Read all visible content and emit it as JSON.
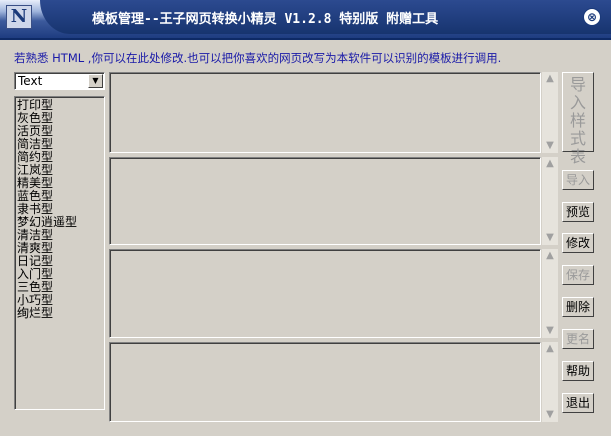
{
  "window": {
    "logo": "N",
    "title": "模板管理--王子网页转换小精灵 V1.2.8 特别版 附赠工具",
    "close_glyph": "⊗"
  },
  "hint": "若熟悉 HTML ,你可以在此处修改.也可以把你喜欢的网页改写为本软件可以识别的模板进行调用.",
  "combo": {
    "value": "Text",
    "arrow": "▼"
  },
  "list_items": [
    "打印型",
    "灰色型",
    "活页型",
    "简洁型",
    "简约型",
    "江岚型",
    "精美型",
    "蓝色型",
    "隶书型",
    "梦幻逍遥型",
    "清洁型",
    "清爽型",
    "日记型",
    "入门型",
    "三色型",
    "小巧型",
    "绚烂型"
  ],
  "scroll": {
    "up": "▲",
    "down": "▼"
  },
  "buttons": {
    "import_style": [
      "导",
      "入",
      "样",
      "式",
      "表"
    ],
    "import": "导入",
    "preview": "预览",
    "modify": "修改",
    "save": "保存",
    "delete": "删除",
    "rename": "更名",
    "help": "帮助",
    "exit": "退出"
  },
  "colors": {
    "hint_text": "#1a1aa8",
    "title_bg": "#1e3c80",
    "window_bg": "#d4d0c8"
  }
}
